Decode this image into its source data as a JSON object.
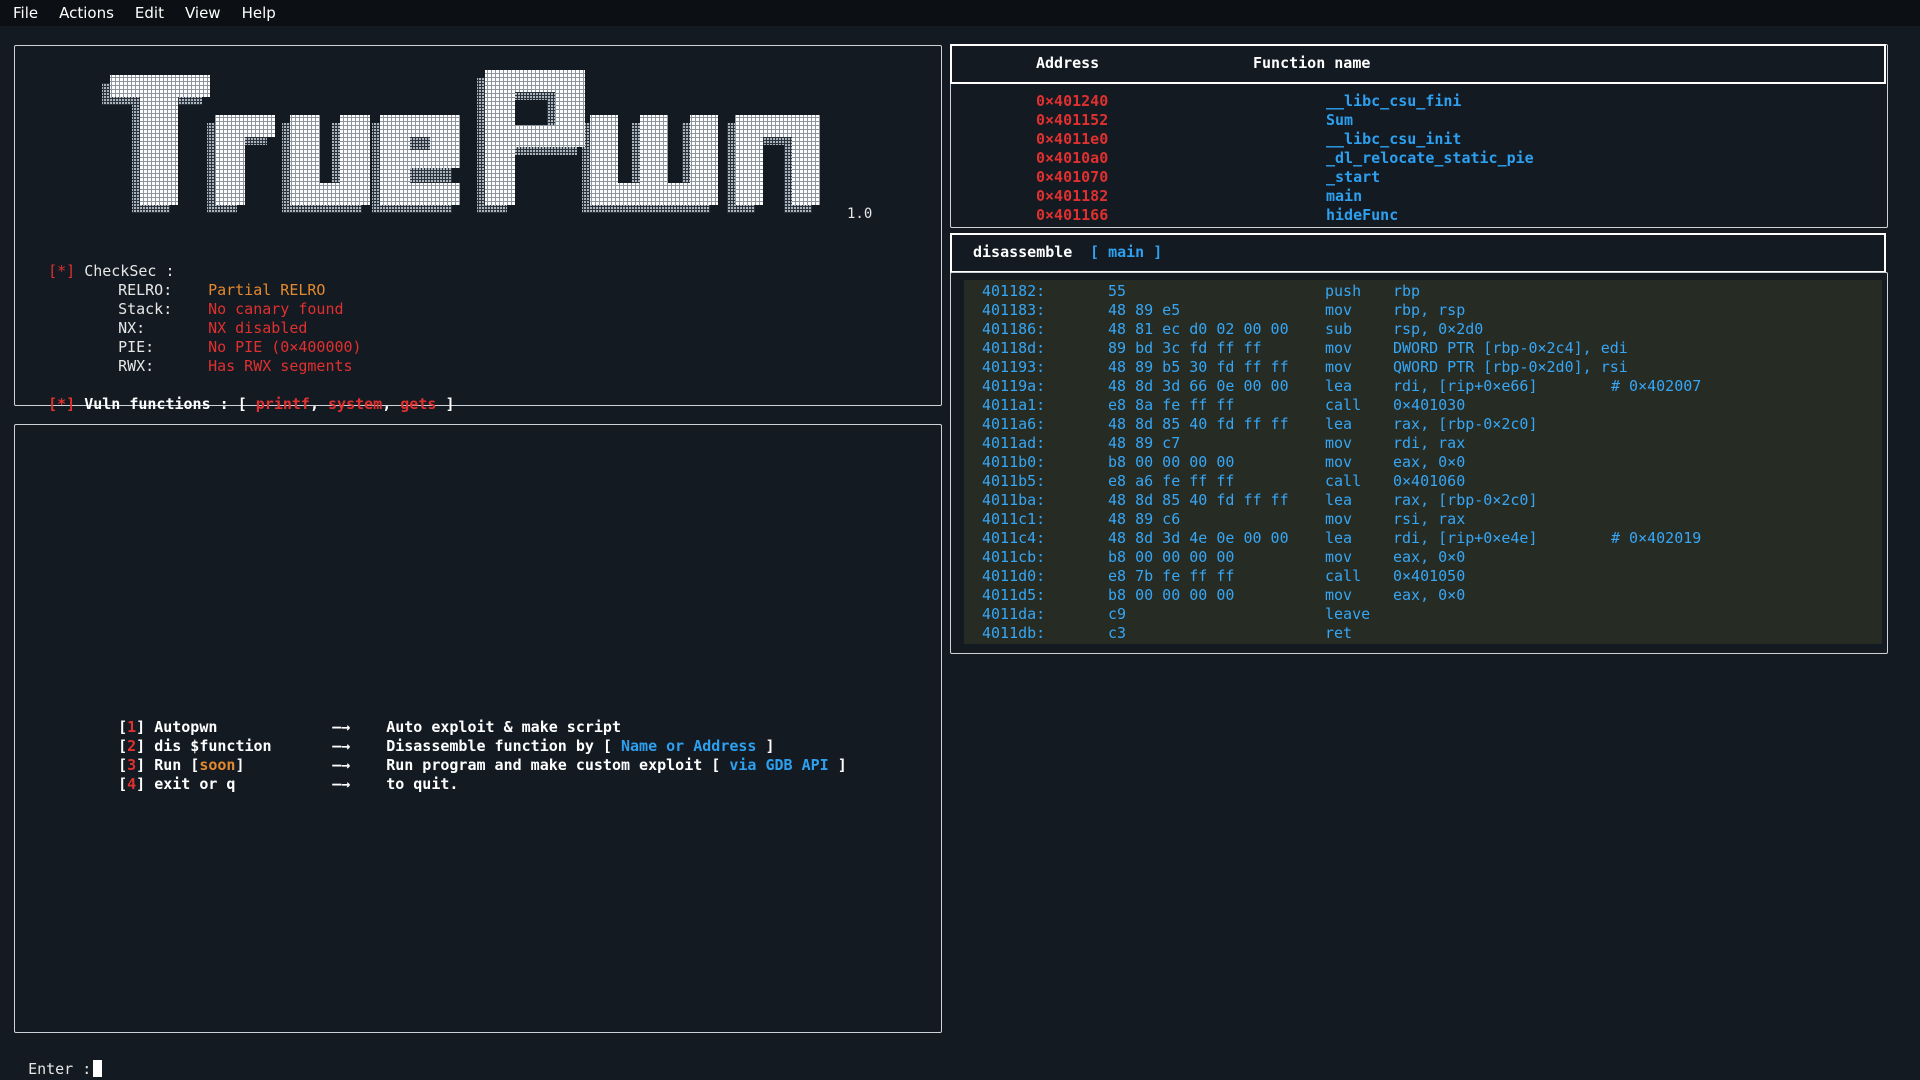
{
  "menubar": {
    "items": [
      "File",
      "Actions",
      "Edit",
      "View",
      "Help"
    ]
  },
  "logo": {
    "text": "TruePwn",
    "version": "1.0"
  },
  "checksec": {
    "marker": "[*]",
    "title": "CheckSec :",
    "rows": [
      {
        "label": "RELRO:",
        "value": "Partial RELRO",
        "color": "#e5892f"
      },
      {
        "label": "Stack:",
        "value": "No canary found",
        "color": "#e0302f"
      },
      {
        "label": "NX:",
        "value": "NX disabled",
        "color": "#e0302f"
      },
      {
        "label": "PIE:",
        "value": "No PIE (0×400000)",
        "color": "#e0302f"
      },
      {
        "label": "RWX:",
        "value": "Has RWX segments",
        "color": "#e0302f"
      }
    ]
  },
  "vuln": {
    "marker": "[*]",
    "label": "Vuln functions : [",
    "functions": [
      "printf",
      "system",
      "gets"
    ],
    "close": "]"
  },
  "menu": {
    "options": [
      {
        "num": "1",
        "label": "Autopwn",
        "arrow": "—→",
        "desc": "Auto exploit & make script"
      },
      {
        "num": "2",
        "label": "dis $function",
        "arrow": "—→",
        "desc": "Disassemble function by [",
        "hl": "Name or Address",
        "desc_end": "]"
      },
      {
        "num": "3",
        "label": "Run [",
        "label_hl": "soon",
        "label_end": "]",
        "arrow": "—→",
        "desc": "Run program and make custom exploit [",
        "hl": "via GDB API",
        "desc_end": "]"
      },
      {
        "num": "4",
        "label": "exit or q",
        "arrow": "—→",
        "desc": "to quit."
      }
    ]
  },
  "prompt": {
    "label": "Enter :"
  },
  "functions_table": {
    "headers": {
      "address": "Address",
      "name": "Function name"
    },
    "rows": [
      {
        "address": "0×401240",
        "name": "__libc_csu_fini"
      },
      {
        "address": "0×401152",
        "name": "Sum"
      },
      {
        "address": "0×4011e0",
        "name": "__libc_csu_init"
      },
      {
        "address": "0×4010a0",
        "name": "_dl_relocate_static_pie"
      },
      {
        "address": "0×401070",
        "name": "_start"
      },
      {
        "address": "0×401182",
        "name": "main"
      },
      {
        "address": "0×401166",
        "name": "hideFunc"
      }
    ]
  },
  "disassemble": {
    "title": "disassemble",
    "target_open": "[",
    "target": "main",
    "target_close": "]",
    "rows": [
      {
        "addr": "401182:",
        "bytes": "55",
        "op": "push",
        "args": "rbp",
        "cmt": ""
      },
      {
        "addr": "401183:",
        "bytes": "48 89 e5",
        "op": "mov",
        "args": "rbp, rsp",
        "cmt": ""
      },
      {
        "addr": "401186:",
        "bytes": "48 81 ec d0 02 00 00",
        "op": "sub",
        "args": "rsp, 0×2d0",
        "cmt": ""
      },
      {
        "addr": "40118d:",
        "bytes": "89 bd 3c fd ff ff",
        "op": "mov",
        "args": "DWORD PTR [rbp-0×2c4], edi",
        "cmt": ""
      },
      {
        "addr": "401193:",
        "bytes": "48 89 b5 30 fd ff ff",
        "op": "mov",
        "args": "QWORD PTR [rbp-0×2d0], rsi",
        "cmt": ""
      },
      {
        "addr": "40119a:",
        "bytes": "48 8d 3d 66 0e 00 00",
        "op": "lea",
        "args": "rdi, [rip+0×e66]",
        "cmt": "# 0×402007"
      },
      {
        "addr": "4011a1:",
        "bytes": "e8 8a fe ff ff",
        "op": "call",
        "args": "0×401030",
        "cmt": ""
      },
      {
        "addr": "4011a6:",
        "bytes": "48 8d 85 40 fd ff ff",
        "op": "lea",
        "args": "rax, [rbp-0×2c0]",
        "cmt": ""
      },
      {
        "addr": "4011ad:",
        "bytes": "48 89 c7",
        "op": "mov",
        "args": "rdi, rax",
        "cmt": ""
      },
      {
        "addr": "4011b0:",
        "bytes": "b8 00 00 00 00",
        "op": "mov",
        "args": "eax, 0×0",
        "cmt": ""
      },
      {
        "addr": "4011b5:",
        "bytes": "e8 a6 fe ff ff",
        "op": "call",
        "args": "0×401060",
        "cmt": ""
      },
      {
        "addr": "4011ba:",
        "bytes": "48 8d 85 40 fd ff ff",
        "op": "lea",
        "args": "rax, [rbp-0×2c0]",
        "cmt": ""
      },
      {
        "addr": "4011c1:",
        "bytes": "48 89 c6",
        "op": "mov",
        "args": "rsi, rax",
        "cmt": ""
      },
      {
        "addr": "4011c4:",
        "bytes": "48 8d 3d 4e 0e 00 00",
        "op": "lea",
        "args": "rdi, [rip+0×e4e]",
        "cmt": "# 0×402019"
      },
      {
        "addr": "4011cb:",
        "bytes": "b8 00 00 00 00",
        "op": "mov",
        "args": "eax, 0×0",
        "cmt": ""
      },
      {
        "addr": "4011d0:",
        "bytes": "e8 7b fe ff ff",
        "op": "call",
        "args": "0×401050",
        "cmt": ""
      },
      {
        "addr": "4011d5:",
        "bytes": "b8 00 00 00 00",
        "op": "mov",
        "args": "eax, 0×0",
        "cmt": ""
      },
      {
        "addr": "4011da:",
        "bytes": "c9",
        "op": "leave",
        "args": "",
        "cmt": ""
      },
      {
        "addr": "4011db:",
        "bytes": "c3",
        "op": "ret",
        "args": "",
        "cmt": ""
      }
    ]
  },
  "colors": {
    "background": "#131a22",
    "accent_red": "#e0302f",
    "accent_blue": "#2da0f0",
    "accent_orange": "#e5892f"
  }
}
